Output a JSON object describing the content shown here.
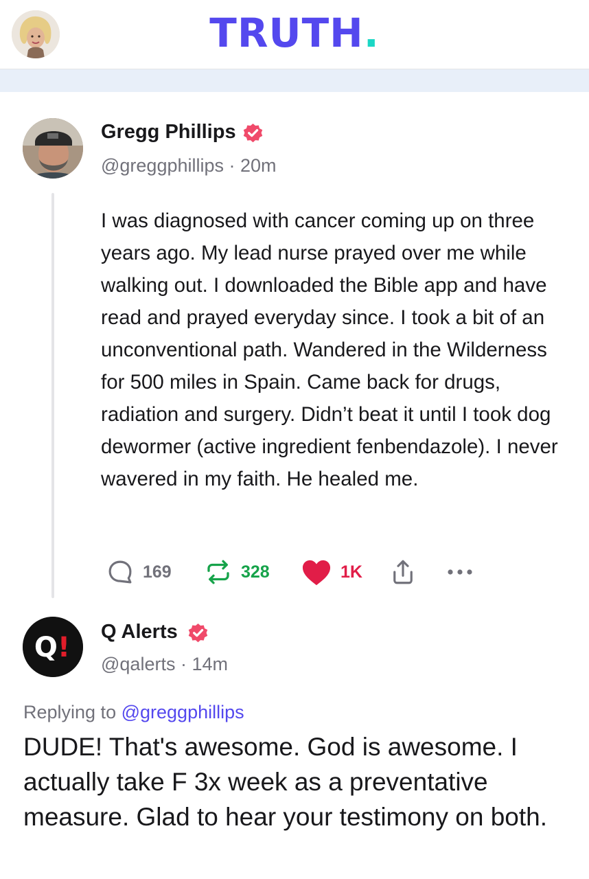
{
  "header": {
    "logo_text": "TRUTH",
    "logo_dot": ".",
    "logo_color": "#5448ee",
    "logo_dot_color": "#1bd7c5"
  },
  "post": {
    "author_name": "Gregg Phillips",
    "handle": "@greggphillips",
    "time": "20m",
    "verified_icon": "verified-badge-icon",
    "body": "I was diagnosed with cancer coming up on three years ago. My lead nurse prayed over me while walking out. I downloaded the Bible app and have read and prayed everyday since. I took a bit of an unconventional path. Wandered in the Wilderness for 500 miles in Spain. Came back for drugs, radiation and surgery. Didn’t beat it until I took dog dewormer (active ingredient fenbendazole). I never wavered in my faith. He healed me.",
    "actions": {
      "replies": "169",
      "retruths": "328",
      "likes": "1K",
      "reply_icon": "reply-icon",
      "retruth_icon": "retruth-icon",
      "like_icon": "heart-icon",
      "share_icon": "share-icon",
      "more_icon": "more-icon"
    }
  },
  "reply": {
    "author_name": "Q Alerts",
    "handle": "@qalerts",
    "time": "14m",
    "avatar_text": "Q!",
    "replying_label": "Replying to",
    "replying_to": "@greggphillips",
    "body": "DUDE! That's awesome. God is awesome. I actually take F 3x week as a preventative measure. Glad to hear your testimony on both."
  },
  "colors": {
    "accent": "#5448ee",
    "verified": "#f04a6a",
    "retruth": "#16a34a",
    "like": "#e11d48",
    "muted": "#71717a"
  }
}
